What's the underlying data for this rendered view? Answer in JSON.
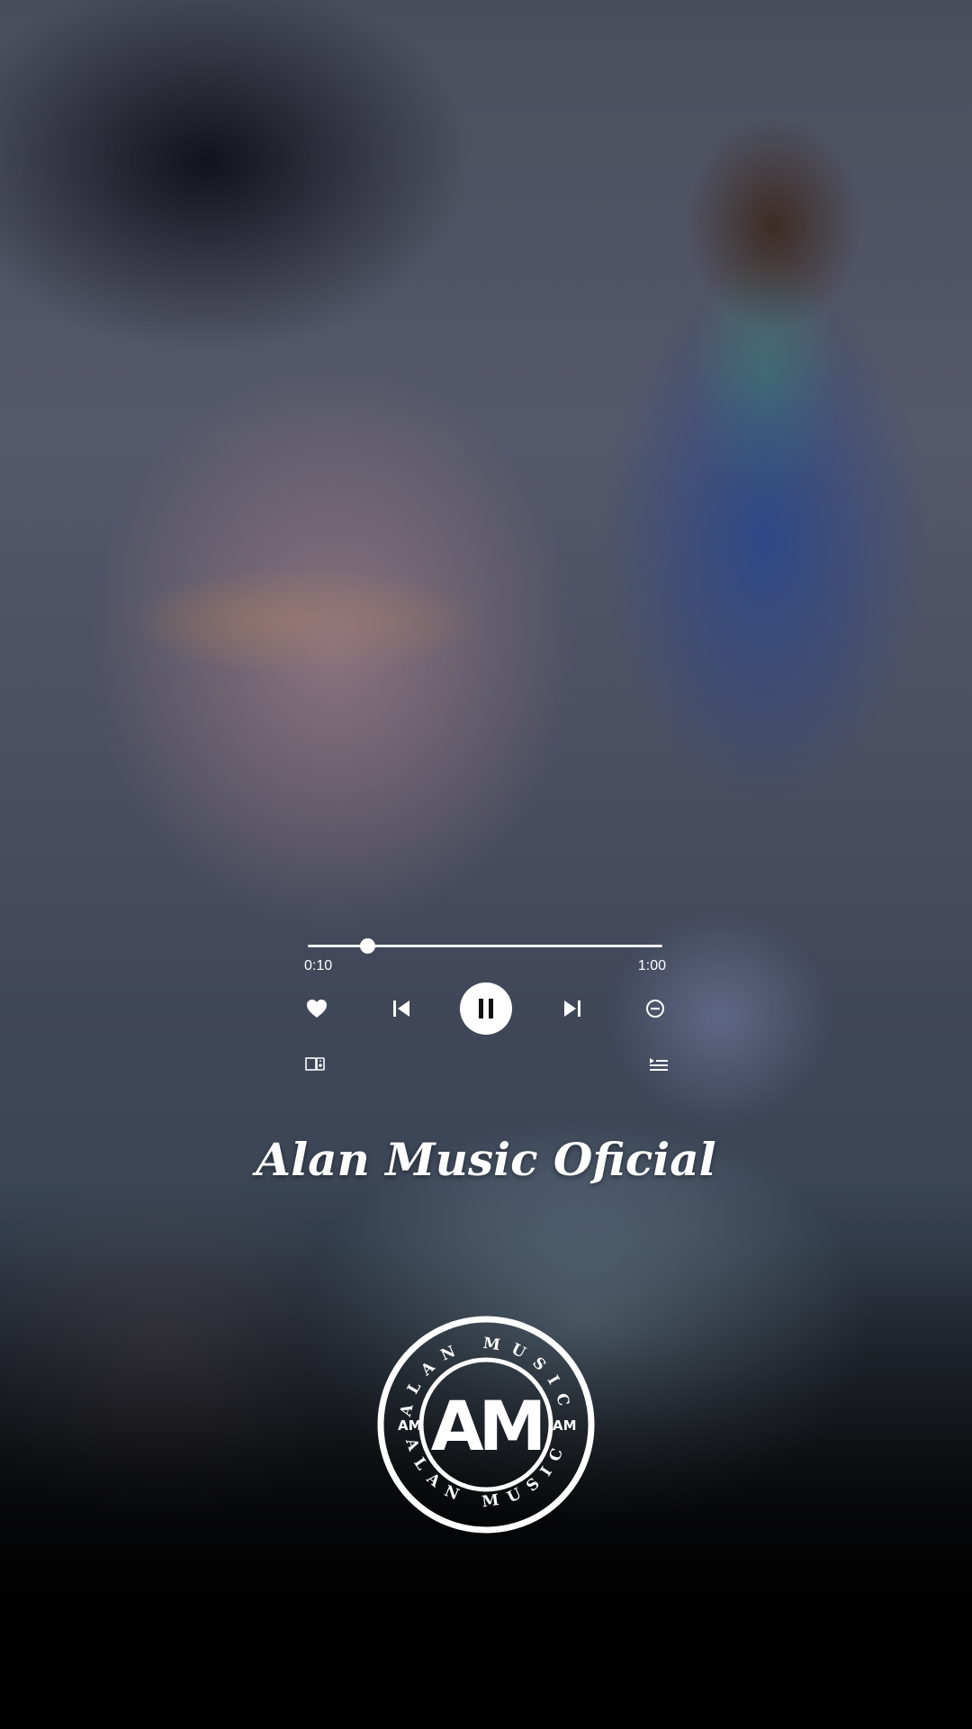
{
  "player": {
    "elapsed": "0:10",
    "duration": "1:00",
    "progress_fraction": 0.167
  },
  "controls": {
    "like_icon": "heart-icon",
    "previous_icon": "skip-previous-icon",
    "play_pause_icon": "pause-icon",
    "next_icon": "skip-next-icon",
    "remove_icon": "minus-circle-icon",
    "device_icon": "cast-device-icon",
    "queue_icon": "queue-list-icon"
  },
  "brand": {
    "channel_name": "Alan Music Oficial",
    "logo_monogram": "AM",
    "logo_ring_text": "ALAN MUSIC"
  },
  "colors": {
    "foreground": "#ffffff",
    "fade_bottom": "#000000"
  }
}
